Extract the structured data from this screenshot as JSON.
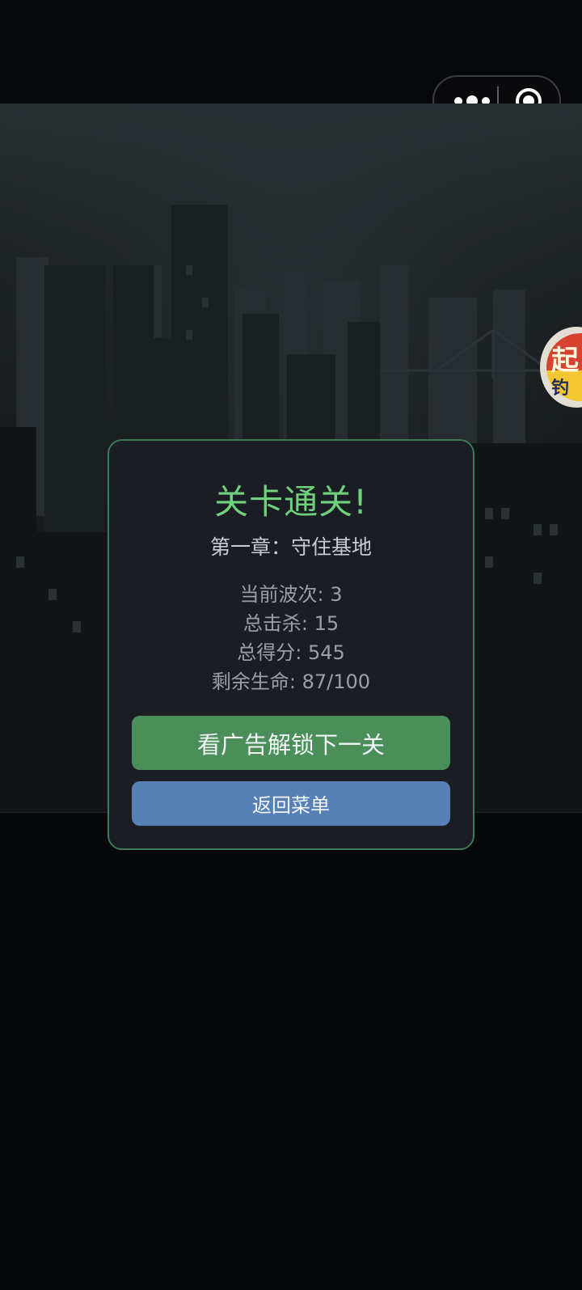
{
  "capsule": {
    "more_icon": "more-dots-icon",
    "close_icon": "target-circle-icon"
  },
  "floating_badge": {
    "char_top": "起",
    "char_bottom": "钓"
  },
  "dialog": {
    "title": "关卡通关!",
    "subtitle": "第一章：守住基地",
    "stats": [
      "当前波次: 3",
      "总击杀: 15",
      "总得分: 545",
      "剩余生命: 87/100"
    ],
    "primary_button": "看广告解锁下一关",
    "secondary_button": "返回菜单"
  },
  "colors": {
    "title": "#6fd17c",
    "dialog_border": "#3b7a55",
    "primary_button": "#4a8f5a",
    "secondary_button": "#5781b6"
  }
}
